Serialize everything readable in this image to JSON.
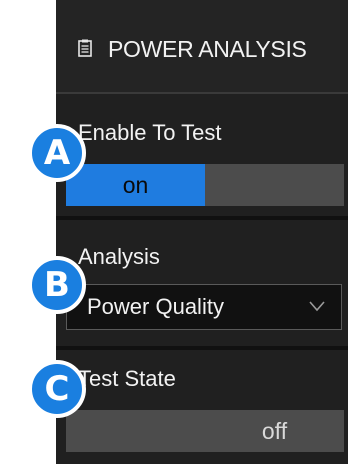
{
  "header": {
    "title": "POWER ANALYSIS",
    "icon": "clipboard-icon"
  },
  "enable_to_test": {
    "label": "Enable To Test",
    "on_label": "on",
    "state": "on"
  },
  "analysis": {
    "label": "Analysis",
    "selected": "Power Quality"
  },
  "test_state": {
    "label": "Test State",
    "off_label": "off",
    "state": "off"
  },
  "callouts": {
    "a": "A",
    "b": "B",
    "c": "C"
  },
  "colors": {
    "accent": "#1f7ce0",
    "panel": "#1b1b1b",
    "badge": "#1a7fe0"
  }
}
